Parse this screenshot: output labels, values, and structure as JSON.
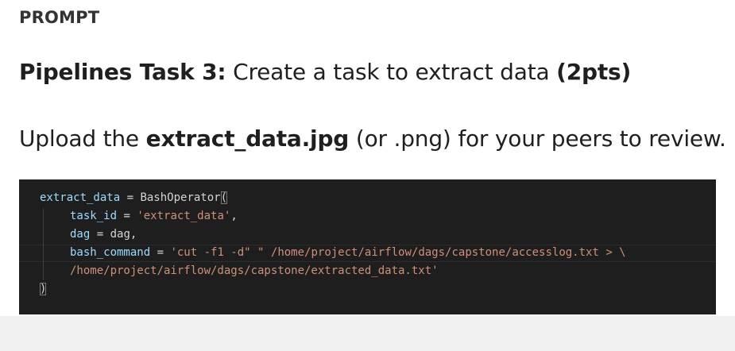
{
  "prompt": {
    "label": "PROMPT",
    "task_bold": "Pipelines Task 3:",
    "task_text": " Create a task to extract data ",
    "task_points": "(2pts)",
    "upload_prefix": "Upload the ",
    "upload_file": "extract_data.jpg",
    "upload_suffix": " (or .png) for your peers to review."
  },
  "code": {
    "line1_var": "extract_data",
    "line1_op": " = BashOperator",
    "line1_paren": "(",
    "line2_key": "task_id",
    "line2_eq": " = ",
    "line2_val": "'extract_data'",
    "line2_comma": ",",
    "line3_key": "dag",
    "line3_rest": " = dag,",
    "line4_key": "bash_command",
    "line4_eq": " = ",
    "line4_val": "'cut -f1 -d\" \" /home/project/airflow/dags/capstone/accesslog.txt > \\",
    "line5_val": "/home/project/airflow/dags/capstone/extracted_data.txt'",
    "line6_paren": ")"
  },
  "colors": {
    "code_background": "#1e1e1e",
    "string": "#ce9178",
    "variable": "#9cdcfe",
    "default_text": "#d4d4d4",
    "page_background": "#ffffff",
    "footer_background": "#f0f0f0"
  }
}
